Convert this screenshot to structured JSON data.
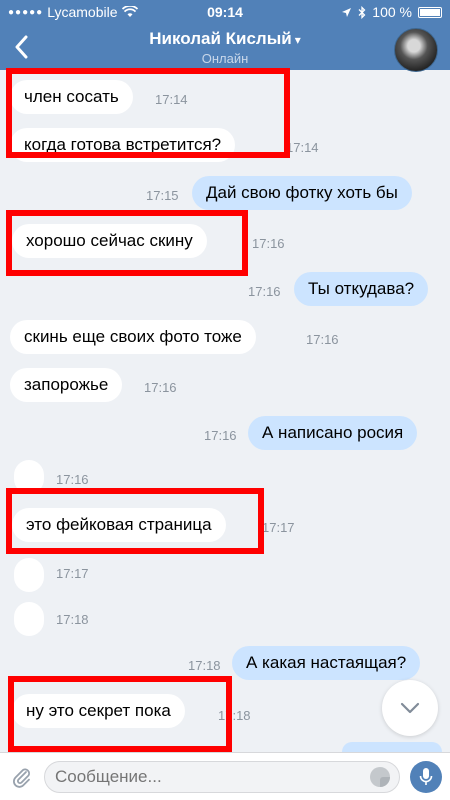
{
  "status_bar": {
    "carrier": "Lycamobile",
    "time": "09:14",
    "battery": "100 %"
  },
  "header": {
    "title": "Николай Кислый",
    "subtitle": "Онлайн"
  },
  "messages": [
    {
      "text": "член сосать",
      "time": "17:14",
      "dir": "in"
    },
    {
      "text": "когда готова встретится?",
      "time": "17:14",
      "dir": "in"
    },
    {
      "text": "Дай свою фотку хоть бы",
      "time": "17:15",
      "dir": "out"
    },
    {
      "text": "хорошо сейчас скину",
      "time": "17:16",
      "dir": "in"
    },
    {
      "text": "Ты откудава?",
      "time": "17:16",
      "dir": "out"
    },
    {
      "text": "скинь еще своих фото тоже",
      "time": "17:16",
      "dir": "in"
    },
    {
      "text": "запорожье",
      "time": "17:16",
      "dir": "in"
    },
    {
      "text": "А написано росия",
      "time": "17:16",
      "dir": "out"
    },
    {
      "text": "",
      "time": "17:16",
      "dir": "in"
    },
    {
      "text": "это фейковая страница",
      "time": "17:17",
      "dir": "in"
    },
    {
      "text": "",
      "time": "17:17",
      "dir": "in"
    },
    {
      "text": "",
      "time": "17:18",
      "dir": "in"
    },
    {
      "text": "А какая настаящая?",
      "time": "17:18",
      "dir": "out"
    },
    {
      "text": "ну это секрет пока",
      "time": "17:18",
      "dir": "in"
    }
  ],
  "composer": {
    "placeholder": "Сообщение..."
  },
  "colors": {
    "header": "#5181b8",
    "background": "#eef1f5",
    "incoming_bubble": "#ffffff",
    "outgoing_bubble": "#cce4ff",
    "highlight": "#ff0000"
  },
  "icons": [
    "back-icon",
    "chevron-down-icon",
    "wifi-icon",
    "location-icon",
    "bluetooth-icon",
    "battery-icon",
    "attach-icon",
    "sticker-icon",
    "mic-icon",
    "scroll-down-icon"
  ]
}
